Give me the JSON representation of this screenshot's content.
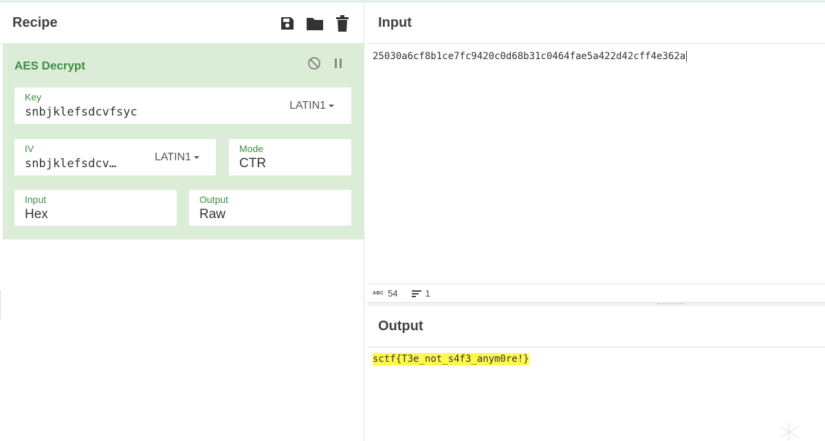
{
  "recipe": {
    "title": "Recipe",
    "icons": [
      "save-icon",
      "folder-icon",
      "trash-icon"
    ],
    "operation": {
      "name": "AES Decrypt",
      "key": {
        "label": "Key",
        "value": "snbjklefsdcvfsyc",
        "encoding": "LATIN1"
      },
      "iv": {
        "label": "IV",
        "value": "snbjklefsdcv…",
        "encoding": "LATIN1"
      },
      "mode": {
        "label": "Mode",
        "value": "CTR"
      },
      "input": {
        "label": "Input",
        "value": "Hex"
      },
      "output": {
        "label": "Output",
        "value": "Raw"
      }
    }
  },
  "input": {
    "title": "Input",
    "text": "25030a6cf8b1ce7fc9420c0d68b31c0464fae5a422d42cff4e362a",
    "char_count": "54",
    "line_count": "1",
    "abc_label": "ABC"
  },
  "output": {
    "title": "Output",
    "text": "sctf{T3e_not_s4f3_anym0re!}"
  },
  "colors": {
    "accent": "#3c8d40",
    "operation_bg": "#dcedd7",
    "highlight": "#fff94d"
  }
}
